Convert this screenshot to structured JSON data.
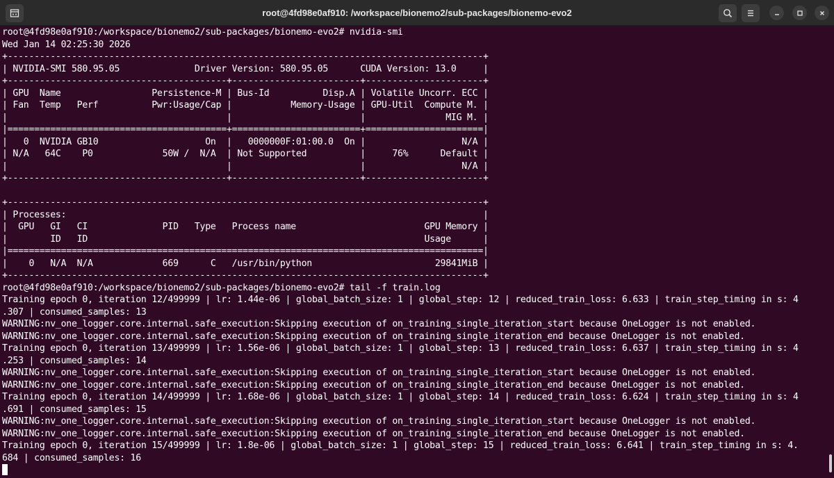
{
  "window": {
    "title": "root@4fd98e0af910: /workspace/bionemo2/sub-packages/bionemo-evo2"
  },
  "icons": {
    "new_tab": "terminal-tab-icon",
    "search": "search-icon",
    "menu": "hamburger-menu-icon",
    "minimize": "minimize-icon",
    "maximize": "maximize-icon",
    "close": "close-icon"
  },
  "terminal": {
    "lines": [
      "root@4fd98e0af910:/workspace/bionemo2/sub-packages/bionemo-evo2# nvidia-smi",
      "Wed Jan 14 02:25:30 2026",
      "+-----------------------------------------------------------------------------------------+",
      "| NVIDIA-SMI 580.95.05              Driver Version: 580.95.05      CUDA Version: 13.0     |",
      "+-----------------------------------------+------------------------+----------------------+",
      "| GPU  Name                 Persistence-M | Bus-Id          Disp.A | Volatile Uncorr. ECC |",
      "| Fan  Temp   Perf          Pwr:Usage/Cap |           Memory-Usage | GPU-Util  Compute M. |",
      "|                                         |                        |               MIG M. |",
      "|=========================================+========================+======================|",
      "|   0  NVIDIA GB10                    On  |   0000000F:01:00.0  On |                  N/A |",
      "| N/A   64C    P0             50W /  N/A  | Not Supported          |     76%      Default |",
      "|                                         |                        |                  N/A |",
      "+-----------------------------------------+------------------------+----------------------+",
      "",
      "+-----------------------------------------------------------------------------------------+",
      "| Processes:                                                                              |",
      "|  GPU   GI   CI              PID   Type   Process name                        GPU Memory |",
      "|        ID   ID                                                               Usage      |",
      "|=========================================================================================|",
      "|    0   N/A  N/A             669      C   /usr/bin/python                       29841MiB |",
      "+-----------------------------------------------------------------------------------------+",
      "root@4fd98e0af910:/workspace/bionemo2/sub-packages/bionemo-evo2# tail -f train.log",
      "Training epoch 0, iteration 12/499999 | lr: 1.44e-06 | global_batch_size: 1 | global_step: 12 | reduced_train_loss: 6.633 | train_step_timing in s: 4",
      ".307 | consumed_samples: 13",
      "WARNING:nv_one_logger.core.internal.safe_execution:Skipping execution of on_training_single_iteration_start because OneLogger is not enabled.",
      "WARNING:nv_one_logger.core.internal.safe_execution:Skipping execution of on_training_single_iteration_end because OneLogger is not enabled.",
      "Training epoch 0, iteration 13/499999 | lr: 1.56e-06 | global_batch_size: 1 | global_step: 13 | reduced_train_loss: 6.637 | train_step_timing in s: 4",
      ".253 | consumed_samples: 14",
      "WARNING:nv_one_logger.core.internal.safe_execution:Skipping execution of on_training_single_iteration_start because OneLogger is not enabled.",
      "WARNING:nv_one_logger.core.internal.safe_execution:Skipping execution of on_training_single_iteration_end because OneLogger is not enabled.",
      "Training epoch 0, iteration 14/499999 | lr: 1.68e-06 | global_batch_size: 1 | global_step: 14 | reduced_train_loss: 6.624 | train_step_timing in s: 4",
      ".691 | consumed_samples: 15",
      "WARNING:nv_one_logger.core.internal.safe_execution:Skipping execution of on_training_single_iteration_start because OneLogger is not enabled.",
      "WARNING:nv_one_logger.core.internal.safe_execution:Skipping execution of on_training_single_iteration_end because OneLogger is not enabled.",
      "Training epoch 0, iteration 15/499999 | lr: 1.8e-06 | global_batch_size: 1 | global_step: 15 | reduced_train_loss: 6.641 | train_step_timing in s: 4.",
      "684 | consumed_samples: 16"
    ]
  }
}
